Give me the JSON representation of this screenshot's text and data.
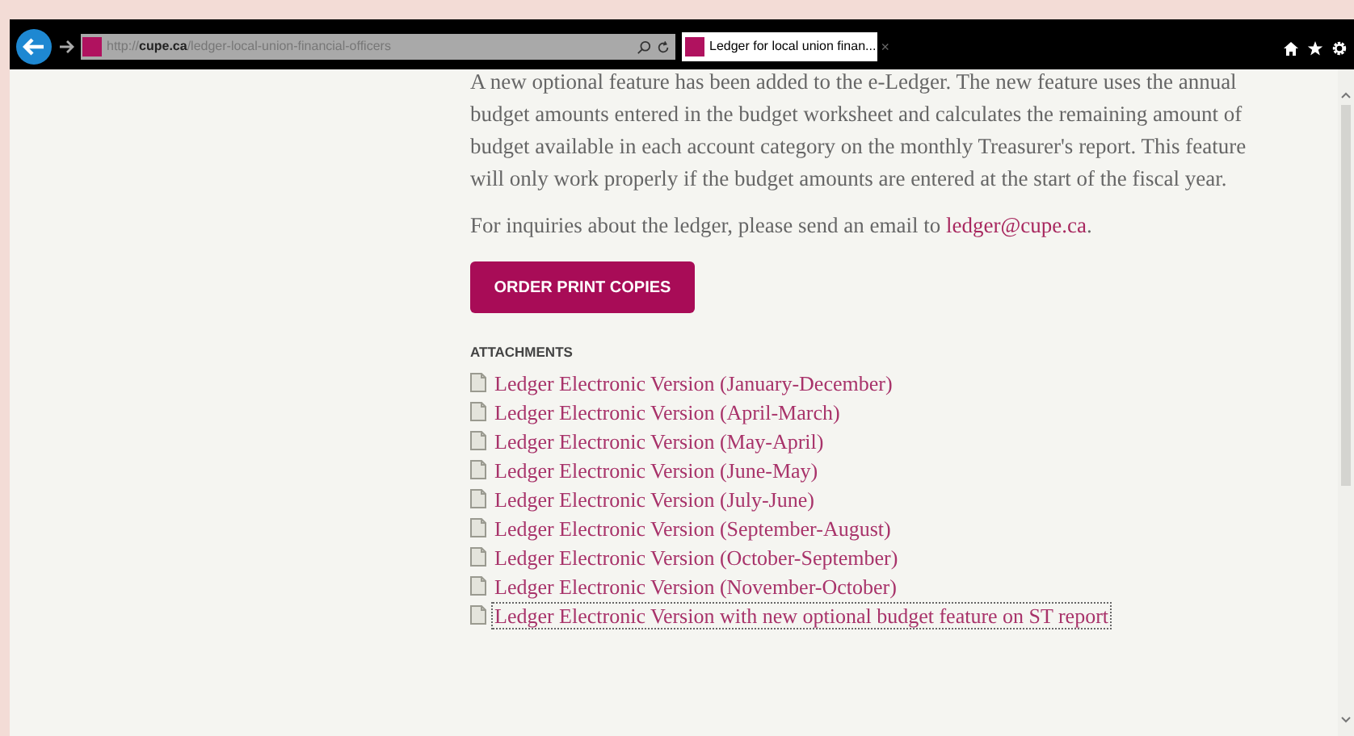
{
  "browser": {
    "address": {
      "scheme": "http://",
      "domain": "cupe.ca",
      "path": "/ledger-local-union-financial-officers"
    },
    "tab": {
      "title": "Ledger for local union finan...",
      "close": "×"
    }
  },
  "content": {
    "intro": "A new optional feature has been added to the e-Ledger. The new feature uses the annual budget amounts entered in the budget worksheet and calculates the remaining amount of budget available in each account category on the monthly Treasurer's report.  This feature will only work properly if the budget amounts are entered at the start of the fiscal year.",
    "inquiry": {
      "text": "For inquiries about the ledger, please send an email to ",
      "link": "ledger@cupe.ca",
      "end": "."
    },
    "order_button": "ORDER PRINT COPIES",
    "attachments_heading": "ATTACHMENTS",
    "attachments": [
      {
        "label": "Ledger Electronic Version (January-December)",
        "focused": false
      },
      {
        "label": "Ledger Electronic Version (April-March)",
        "focused": false
      },
      {
        "label": "Ledger Electronic Version (May-April)",
        "focused": false
      },
      {
        "label": "Ledger Electronic Version (June-May)",
        "focused": false
      },
      {
        "label": "Ledger Electronic Version (July-June)",
        "focused": false
      },
      {
        "label": "Ledger Electronic Version (September-August)",
        "focused": false
      },
      {
        "label": "Ledger Electronic Version (October-September)",
        "focused": false
      },
      {
        "label": "Ledger Electronic Version (November-October)",
        "focused": false
      },
      {
        "label": "Ledger Electronic Version with new optional budget feature on ST report",
        "focused": true
      }
    ]
  }
}
